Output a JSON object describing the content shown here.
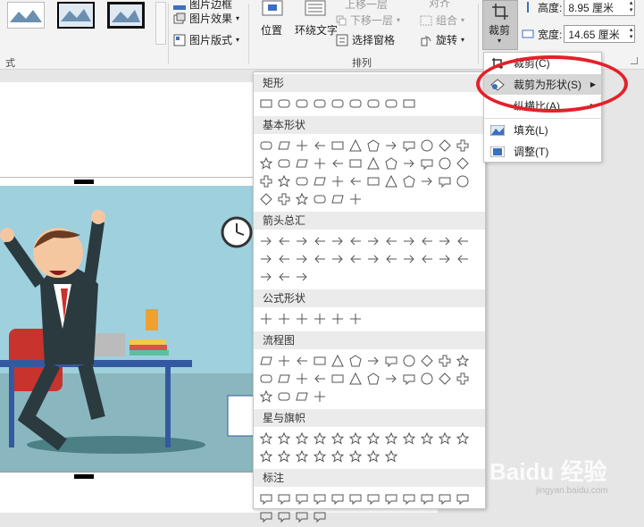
{
  "ribbon": {
    "style_group_label": "式",
    "picture_border": "图片边框",
    "picture_effects": "图片效果",
    "picture_layout": "图片版式",
    "position": "位置",
    "wrap_text": "环绕文字",
    "bring_forward": "上移一层",
    "send_backward": "下移一层",
    "selection_pane": "选择窗格",
    "align": "对齐",
    "group": "组合",
    "rotate": "旋转",
    "arrange_group_label": "排列",
    "crop": "裁剪",
    "height_label": "高度:",
    "height_value": "8.95 厘米",
    "width_label": "宽度:",
    "width_value": "14.65 厘米"
  },
  "crop_menu": {
    "items": [
      {
        "label": "裁剪(C)",
        "icon": "crop-icon"
      },
      {
        "label": "裁剪为形状(S)",
        "icon": "crop-to-shape-icon",
        "selected": true
      },
      {
        "label": "纵横比(A)",
        "icon": ""
      },
      {
        "label": "填充(L)",
        "icon": "fill-icon"
      },
      {
        "label": "调整(T)",
        "icon": "fit-icon"
      }
    ]
  },
  "shapes_gallery": {
    "sections": [
      {
        "title": "矩形",
        "count": 9
      },
      {
        "title": "基本形状",
        "count": 42
      },
      {
        "title": "箭头总汇",
        "count": 27
      },
      {
        "title": "公式形状",
        "count": 6
      },
      {
        "title": "流程图",
        "count": 28
      },
      {
        "title": "星与旗帜",
        "count": 20
      },
      {
        "title": "标注",
        "count": 16
      }
    ]
  },
  "watermark": {
    "text": "Baidu 经验",
    "sub": "jingyan.baidu.com"
  },
  "colors": {
    "highlight_ring": "#e3212a",
    "selected_item": "#d6d6d6"
  }
}
